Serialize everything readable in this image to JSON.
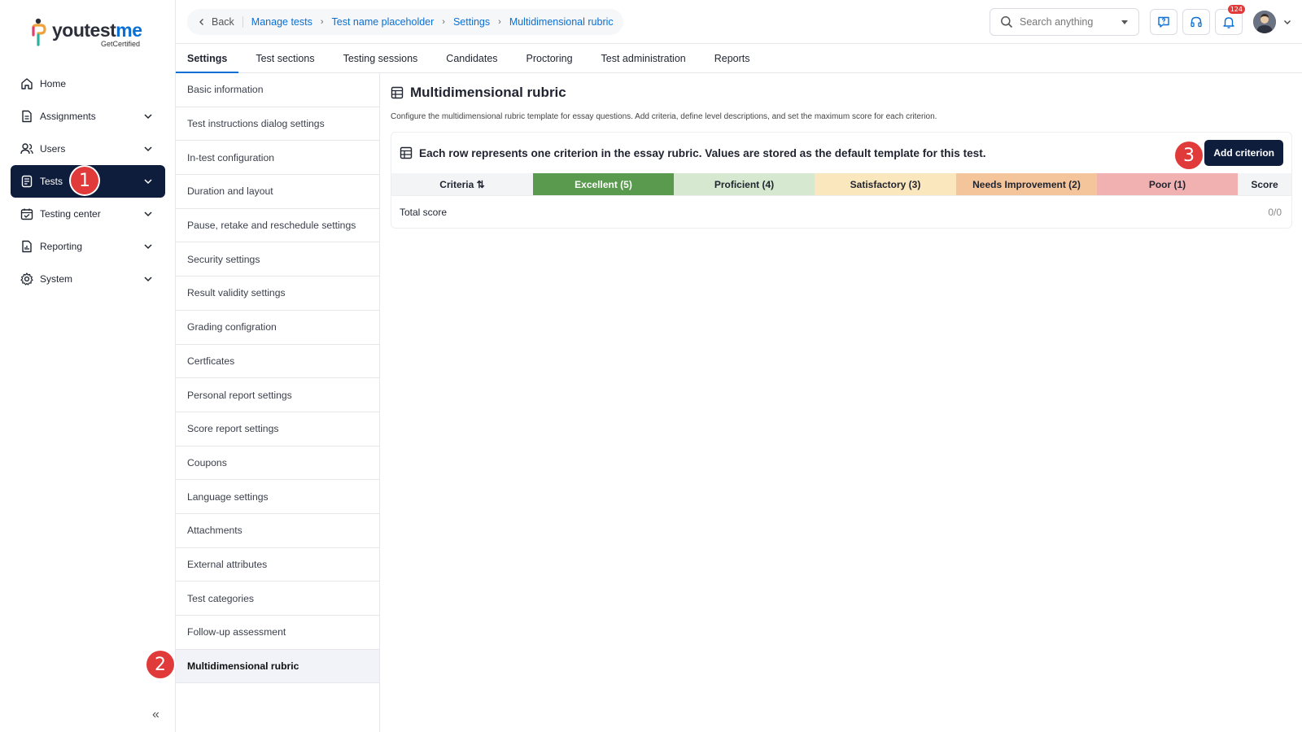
{
  "brand": {
    "name_prefix": "youtest",
    "name_suffix": "me",
    "tagline": "GetCertified"
  },
  "sidebar": {
    "items": [
      {
        "label": "Home",
        "icon": "home-icon",
        "has_chevron": false
      },
      {
        "label": "Assignments",
        "icon": "document-icon",
        "has_chevron": true
      },
      {
        "label": "Users",
        "icon": "users-icon",
        "has_chevron": true
      },
      {
        "label": "Tests",
        "icon": "test-icon",
        "has_chevron": true,
        "active": true
      },
      {
        "label": "Testing center",
        "icon": "calendar-check-icon",
        "has_chevron": true
      },
      {
        "label": "Reporting",
        "icon": "report-icon",
        "has_chevron": true
      },
      {
        "label": "System",
        "icon": "gear-icon",
        "has_chevron": true
      }
    ],
    "collapse_label": "«"
  },
  "markers": [
    "1",
    "2",
    "3"
  ],
  "breadcrumb": {
    "back": "Back",
    "items": [
      "Manage tests",
      "Test name placeholder",
      "Settings",
      "Multidimensional rubric"
    ]
  },
  "search": {
    "placeholder": "Search anything"
  },
  "notifications": {
    "count": "124"
  },
  "tabs": [
    "Settings",
    "Test sections",
    "Testing sessions",
    "Candidates",
    "Proctoring",
    "Test administration",
    "Reports"
  ],
  "settings_menu": [
    "Basic information",
    "Test instructions dialog settings",
    "In-test configuration",
    "Duration and layout",
    "Pause, retake and reschedule settings",
    "Security settings",
    "Result validity settings",
    "Grading configration",
    "Certficates",
    "Personal report settings",
    "Score report settings",
    "Coupons",
    "Language settings",
    "Attachments",
    "External  attributes",
    "Test categories",
    "Follow-up assessment",
    "Multidimensional rubric"
  ],
  "main": {
    "title": "Multidimensional rubric",
    "description": "Configure the multidimensional rubric template for essay questions. Add criteria, define level descriptions, and set the maximum score for each criterion.",
    "card_heading": "Each row represents one criterion in the essay rubric. Values are stored as the default template for this test.",
    "add_button": "Add criterion",
    "columns": [
      {
        "label": "Criteria ⇅",
        "bg": "#f3f4f6",
        "color": "#1f2430"
      },
      {
        "label": "Excellent (5)",
        "bg": "#5a9a4f",
        "color": "#ffffff"
      },
      {
        "label": "Proficient (4)",
        "bg": "#d6e8cf",
        "color": "#1f2430"
      },
      {
        "label": "Satisfactory (3)",
        "bg": "#fbe7bd",
        "color": "#1f2430"
      },
      {
        "label": "Needs Improvement (2)",
        "bg": "#f4c49a",
        "color": "#1f2430"
      },
      {
        "label": "Poor (1)",
        "bg": "#f1b1b1",
        "color": "#1f2430"
      },
      {
        "label": "Score",
        "bg": "#f3f4f6",
        "color": "#1f2430"
      }
    ],
    "total_label": "Total score",
    "total_value": "0/0"
  },
  "colors": {
    "accent": "#0b6fd3",
    "dark_navy": "#0f1d3d",
    "marker_red": "#e03a3a"
  }
}
